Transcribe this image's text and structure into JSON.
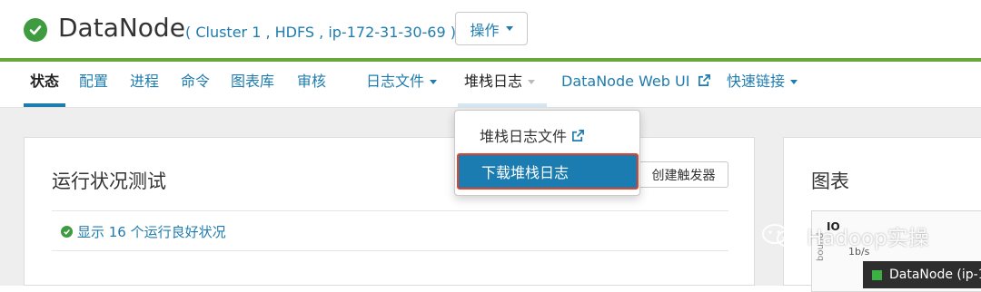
{
  "header": {
    "title": "DataNode",
    "subtitle": "( Cluster 1 , HDFS , ip-172-31-30-69 )",
    "actions_label": "操作",
    "status_color": "#3e9b40",
    "accent_color": "#68a83a"
  },
  "tabs": [
    {
      "label": "状态",
      "active": true
    },
    {
      "label": "配置"
    },
    {
      "label": "进程"
    },
    {
      "label": "命令"
    },
    {
      "label": "图表库"
    },
    {
      "label": "审核"
    },
    {
      "label": "日志文件",
      "dropdown": true
    },
    {
      "label": "堆栈日志",
      "dropdown": true,
      "open": true
    },
    {
      "label": "DataNode Web UI",
      "external": true
    },
    {
      "label": "快速链接",
      "dropdown": true
    }
  ],
  "dropdown": {
    "items": [
      {
        "label": "堆栈日志文件",
        "external": true
      },
      {
        "label": "下载堆栈日志",
        "highlighted": true
      }
    ]
  },
  "health_panel": {
    "title": "运行状况测试",
    "trigger_button": "创建触发器",
    "summary": "显示 16 个运行良好状况"
  },
  "charts_panel": {
    "title": "图表",
    "chart_label": "IO",
    "chart_unit": "1b/s",
    "axis_label": "bound",
    "tooltip_label": "DataNode (ip-1"
  },
  "watermark": {
    "text": "Hadoop实操"
  }
}
